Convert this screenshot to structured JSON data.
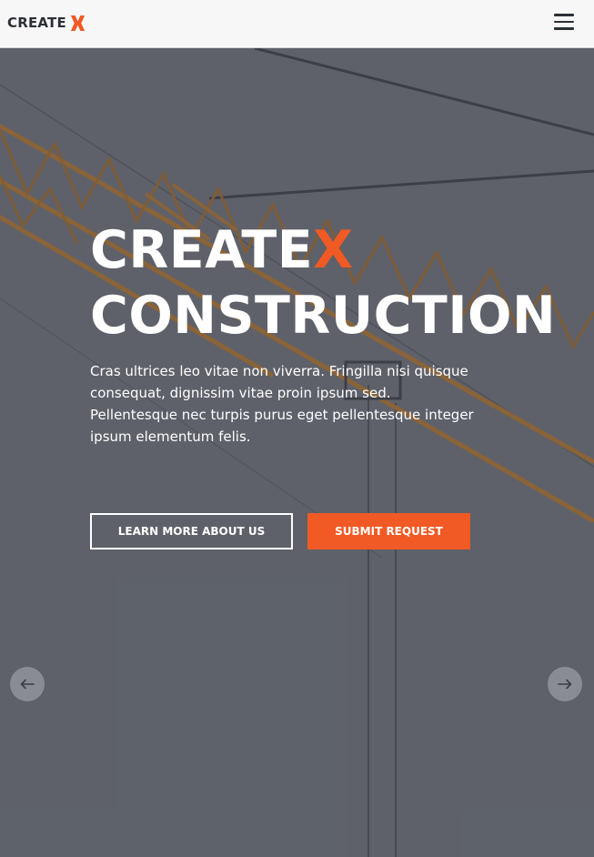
{
  "header": {
    "logo_text": "CREATE",
    "logo_mark": "X",
    "menu_icon": "hamburger-menu-icon"
  },
  "hero": {
    "title_line1_main": "CREATE",
    "title_line1_accent": "X",
    "title_line2": "CONSTRUCTION",
    "description": "Cras ultrices leo vitae non viverra. Fringilla nisi quisque consequat, dignissim vitae proin ipsum sed. Pellentesque nec turpis purus eget pellentesque integer ipsum elementum felis.",
    "learn_more_label": "LEARN MORE ABOUT US",
    "submit_label": "SUBMIT REQUEST",
    "prev_icon": "arrow-left-icon",
    "next_icon": "arrow-right-icon"
  },
  "colors": {
    "accent": "#f15a24",
    "header_bg": "#f7f7f7",
    "hero_tint": "#6a6e76",
    "text_dark": "#2b2f36"
  }
}
